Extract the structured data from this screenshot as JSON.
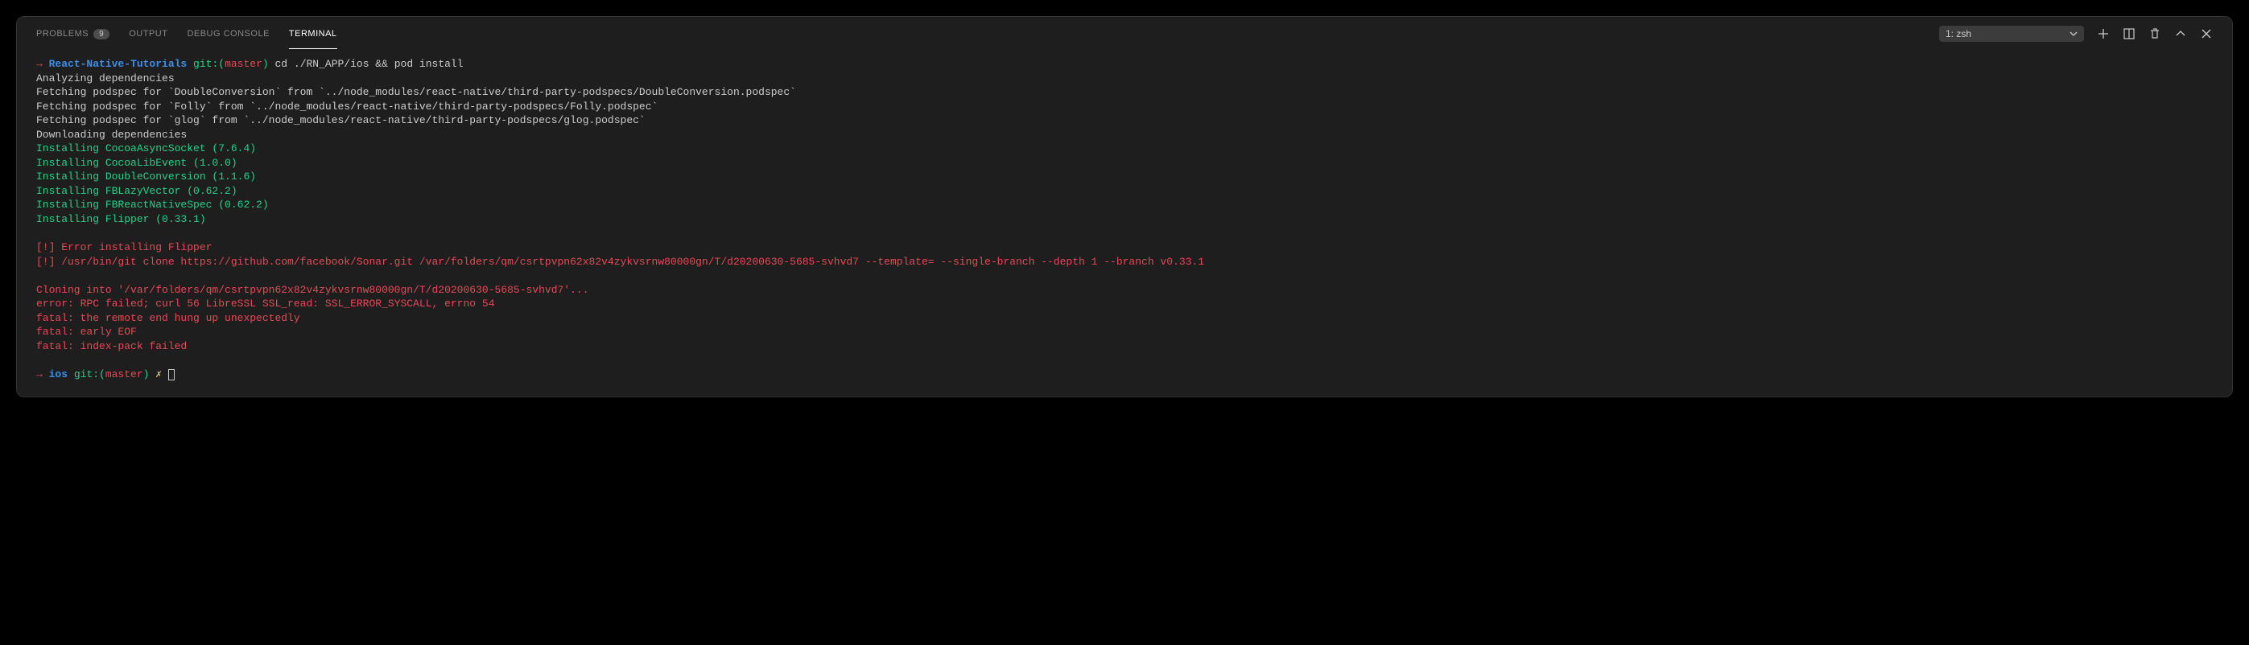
{
  "tabs": {
    "problems": "PROBLEMS",
    "problems_badge": "9",
    "output": "OUTPUT",
    "debug": "DEBUG CONSOLE",
    "terminal": "TERMINAL"
  },
  "dropdown": {
    "selected": "1: zsh"
  },
  "prompt1": {
    "arrow": "→ ",
    "dir": "React-Native-Tutorials",
    "git_label": " git:(",
    "branch": "master",
    "close_paren": ")",
    "command": " cd ./RN_APP/ios && pod install"
  },
  "lines": {
    "l1": "Analyzing dependencies",
    "l2": "Fetching podspec for `DoubleConversion` from `../node_modules/react-native/third-party-podspecs/DoubleConversion.podspec`",
    "l3": "Fetching podspec for `Folly` from `../node_modules/react-native/third-party-podspecs/Folly.podspec`",
    "l4": "Fetching podspec for `glog` from `../node_modules/react-native/third-party-podspecs/glog.podspec`",
    "l5": "Downloading dependencies",
    "i1": "Installing CocoaAsyncSocket (7.6.4)",
    "i2": "Installing CocoaLibEvent (1.0.0)",
    "i3": "Installing DoubleConversion (1.1.6)",
    "i4": "Installing FBLazyVector (0.62.2)",
    "i5": "Installing FBReactNativeSpec (0.62.2)",
    "i6": "Installing Flipper (0.33.1)",
    "e1": "[!] Error installing Flipper",
    "e2": "[!] /usr/bin/git clone https://github.com/facebook/Sonar.git /var/folders/qm/csrtpvpn62x82v4zykvsrnw80000gn/T/d20200630-5685-svhvd7 --template= --single-branch --depth 1 --branch v0.33.1",
    "e3": "Cloning into '/var/folders/qm/csrtpvpn62x82v4zykvsrnw80000gn/T/d20200630-5685-svhvd7'...",
    "e4": "error: RPC failed; curl 56 LibreSSL SSL_read: SSL_ERROR_SYSCALL, errno 54",
    "e5": "fatal: the remote end hung up unexpectedly",
    "e6": "fatal: early EOF",
    "e7": "fatal: index-pack failed"
  },
  "prompt2": {
    "arrow": "→ ",
    "dir": "ios",
    "git_label": " git:(",
    "branch": "master",
    "close_paren": ")",
    "x": " ✗ "
  }
}
